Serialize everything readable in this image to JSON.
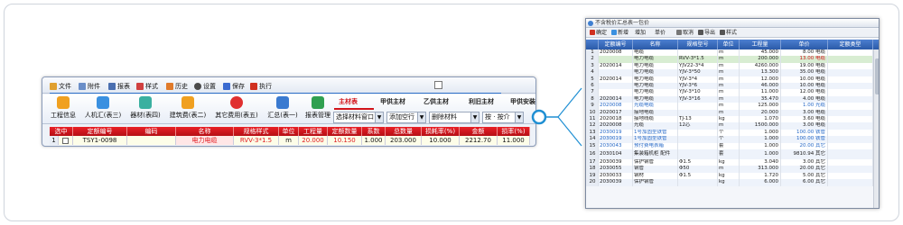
{
  "left": {
    "menu": [
      {
        "label": "文件",
        "color": "#e0a030"
      },
      {
        "label": "附件",
        "color": "#6a8ec8"
      },
      {
        "label": "报表",
        "color": "#4a6fb0"
      },
      {
        "label": "样式",
        "color": "#d04040"
      },
      {
        "label": "历史",
        "color": "#e07a2a"
      },
      {
        "label": "设置",
        "color": "#4a4a4a"
      },
      {
        "label": "保存",
        "color": "#3a6ad0"
      },
      {
        "label": "执行",
        "color": "#d03020"
      }
    ],
    "tools": [
      {
        "label": "工程信息",
        "icon": "house-icon",
        "color": "#f0a020"
      },
      {
        "label": "人机汇(表三)",
        "icon": "layers-icon",
        "color": "#3a90e0"
      },
      {
        "label": "器材(表四)",
        "icon": "box-icon",
        "color": "#3ab0a0"
      },
      {
        "label": "建筑费(表二)",
        "icon": "coins-icon",
        "color": "#f0a020"
      },
      {
        "label": "其它费用(表五)",
        "icon": "money-icon",
        "color": "#e03030"
      },
      {
        "label": "汇总(表一)",
        "icon": "chart-icon",
        "color": "#3a7ad0"
      },
      {
        "label": "报表管理",
        "icon": "report-icon",
        "color": "#30a050"
      }
    ],
    "tabs": [
      "主材表",
      "甲供主材",
      "乙供主材",
      "利旧主材",
      "甲供安装"
    ],
    "controls": {
      "select_material": "选择材料窗口",
      "add_row": "添加空行",
      "delete_material": "删除材料",
      "sort": "按 · 按介"
    },
    "grid_headers": [
      "选中",
      "定额编号",
      "编码",
      "名称",
      "规格样式",
      "单位",
      "工程量",
      "定额数量",
      "系数",
      "总数量",
      "损耗率(%)",
      "金额",
      "损率(%)"
    ],
    "grid_row": {
      "index": "1",
      "code": "TSY1-0098",
      "material_code": "",
      "name": "电力电缆",
      "spec": "RVV-3*1.5",
      "unit": "m",
      "work_qty": "20.000",
      "quota_qty": "10.150",
      "coef": "1.000",
      "total_qty": "203.000",
      "loss_rate": "10.000",
      "amount": "2212.70",
      "loss2": "11.000"
    }
  },
  "right": {
    "title": "不含税价汇总表一包价",
    "toolbar": [
      "确定",
      "新增",
      "增加",
      "单价",
      "取消",
      "导出",
      "样式"
    ],
    "headers": [
      "",
      "定额编号",
      "名称",
      "规格型号",
      "单位",
      "工程量",
      "单价",
      "定额类型"
    ],
    "rows": [
      {
        "n": "1",
        "code": "2020008",
        "name": "电缆",
        "spec": "",
        "unit": "m",
        "qty": "45.000",
        "price": "8.00 电缆",
        "type": "",
        "hl": false,
        "blue": false
      },
      {
        "n": "2",
        "code": "",
        "name": "电力电缆",
        "spec": "RVV-3*1.5",
        "unit": "m",
        "qty": "200.000",
        "price": "13.00 电缆",
        "type": "",
        "hl": true,
        "blue": false
      },
      {
        "n": "3",
        "code": "2020014",
        "name": "电力电缆",
        "spec": "YJV22-3*4",
        "unit": "m",
        "qty": "4260.000",
        "price": "19.00 电缆",
        "type": "",
        "hl": false,
        "blue": false
      },
      {
        "n": "4",
        "code": "",
        "name": "电力电缆",
        "spec": "YJV-3*50",
        "unit": "m",
        "qty": "13.300",
        "price": "35.00 电缆",
        "type": "",
        "hl": false,
        "blue": false
      },
      {
        "n": "5",
        "code": "2020014",
        "name": "电力电缆",
        "spec": "YJV-3*4",
        "unit": "m",
        "qty": "12.000",
        "price": "10.00 电缆",
        "type": "",
        "hl": false,
        "blue": false
      },
      {
        "n": "6",
        "code": "",
        "name": "电力电缆",
        "spec": "YJV-3*6",
        "unit": "m",
        "qty": "46.000",
        "price": "10.00 电缆",
        "type": "",
        "hl": false,
        "blue": false
      },
      {
        "n": "7",
        "code": "",
        "name": "电力电缆",
        "spec": "YJV-3*10",
        "unit": "m",
        "qty": "11.000",
        "price": "12.00 电缆",
        "type": "",
        "hl": false,
        "blue": false
      },
      {
        "n": "8",
        "code": "2020014",
        "name": "电力电缆",
        "spec": "YJV-3*16",
        "unit": "m",
        "qty": "35.470",
        "price": "4.00 电缆",
        "type": "",
        "hl": false,
        "blue": false
      },
      {
        "n": "9",
        "code": "2020008",
        "name": "光缆电缆",
        "spec": "",
        "unit": "m",
        "qty": "125.000",
        "price": "1.00 光缆",
        "type": "",
        "hl": false,
        "blue": true
      },
      {
        "n": "10",
        "code": "2020017",
        "name": "接地电缆",
        "spec": "",
        "unit": "m",
        "qty": "20.000",
        "price": "3.00 电缆",
        "type": "",
        "hl": false,
        "blue": false
      },
      {
        "n": "11",
        "code": "2020018",
        "name": "接地线缆",
        "spec": "TJ-13",
        "unit": "kg",
        "qty": "1.070",
        "price": "3.60 电缆",
        "type": "",
        "hl": false,
        "blue": false
      },
      {
        "n": "12",
        "code": "2020008",
        "name": "光缆",
        "spec": "12芯",
        "unit": "m",
        "qty": "1500.000",
        "price": "3.00 电缆",
        "type": "",
        "hl": false,
        "blue": false
      },
      {
        "n": "13",
        "code": "2030019",
        "name": "1号加固型铁管",
        "spec": "",
        "unit": "个",
        "qty": "1.000",
        "price": "100.00 铁管",
        "type": "",
        "hl": false,
        "blue": true
      },
      {
        "n": "14",
        "code": "2030019",
        "name": "1号加固型铁管",
        "spec": "",
        "unit": "个",
        "qty": "1.000",
        "price": "100.00 铁管",
        "type": "",
        "hl": false,
        "blue": true
      },
      {
        "n": "15",
        "code": "2030043",
        "name": "预付费电表箱",
        "spec": "",
        "unit": "套",
        "qty": "1.000",
        "price": "20.00 其它",
        "type": "",
        "hl": false,
        "blue": true
      },
      {
        "n": "16",
        "code": "2030104",
        "name": "集装箱机柜 配件",
        "spec": "",
        "unit": "套",
        "qty": "1.000",
        "price": "9810.94 其它",
        "type": "",
        "hl": false,
        "blue": false,
        "tall": true
      },
      {
        "n": "17",
        "code": "2030039",
        "name": "保护钢管",
        "spec": "Φ1.5",
        "unit": "kg",
        "qty": "3.040",
        "price": "3.00 其它",
        "type": "",
        "hl": false,
        "blue": false
      },
      {
        "n": "18",
        "code": "2030055",
        "name": "钢管",
        "spec": "Φ50",
        "unit": "m",
        "qty": "313.000",
        "price": "20.00 其它",
        "type": "",
        "hl": false,
        "blue": false
      },
      {
        "n": "19",
        "code": "2030033",
        "name": "钢材",
        "spec": "Φ1.5",
        "unit": "kg",
        "qty": "1.720",
        "price": "5.00 其它",
        "type": "",
        "hl": false,
        "blue": false
      },
      {
        "n": "20",
        "code": "2030039",
        "name": "保护钢管",
        "spec": "",
        "unit": "kg",
        "qty": "6.000",
        "price": "6.00 其它",
        "type": "",
        "hl": false,
        "blue": false
      }
    ]
  }
}
